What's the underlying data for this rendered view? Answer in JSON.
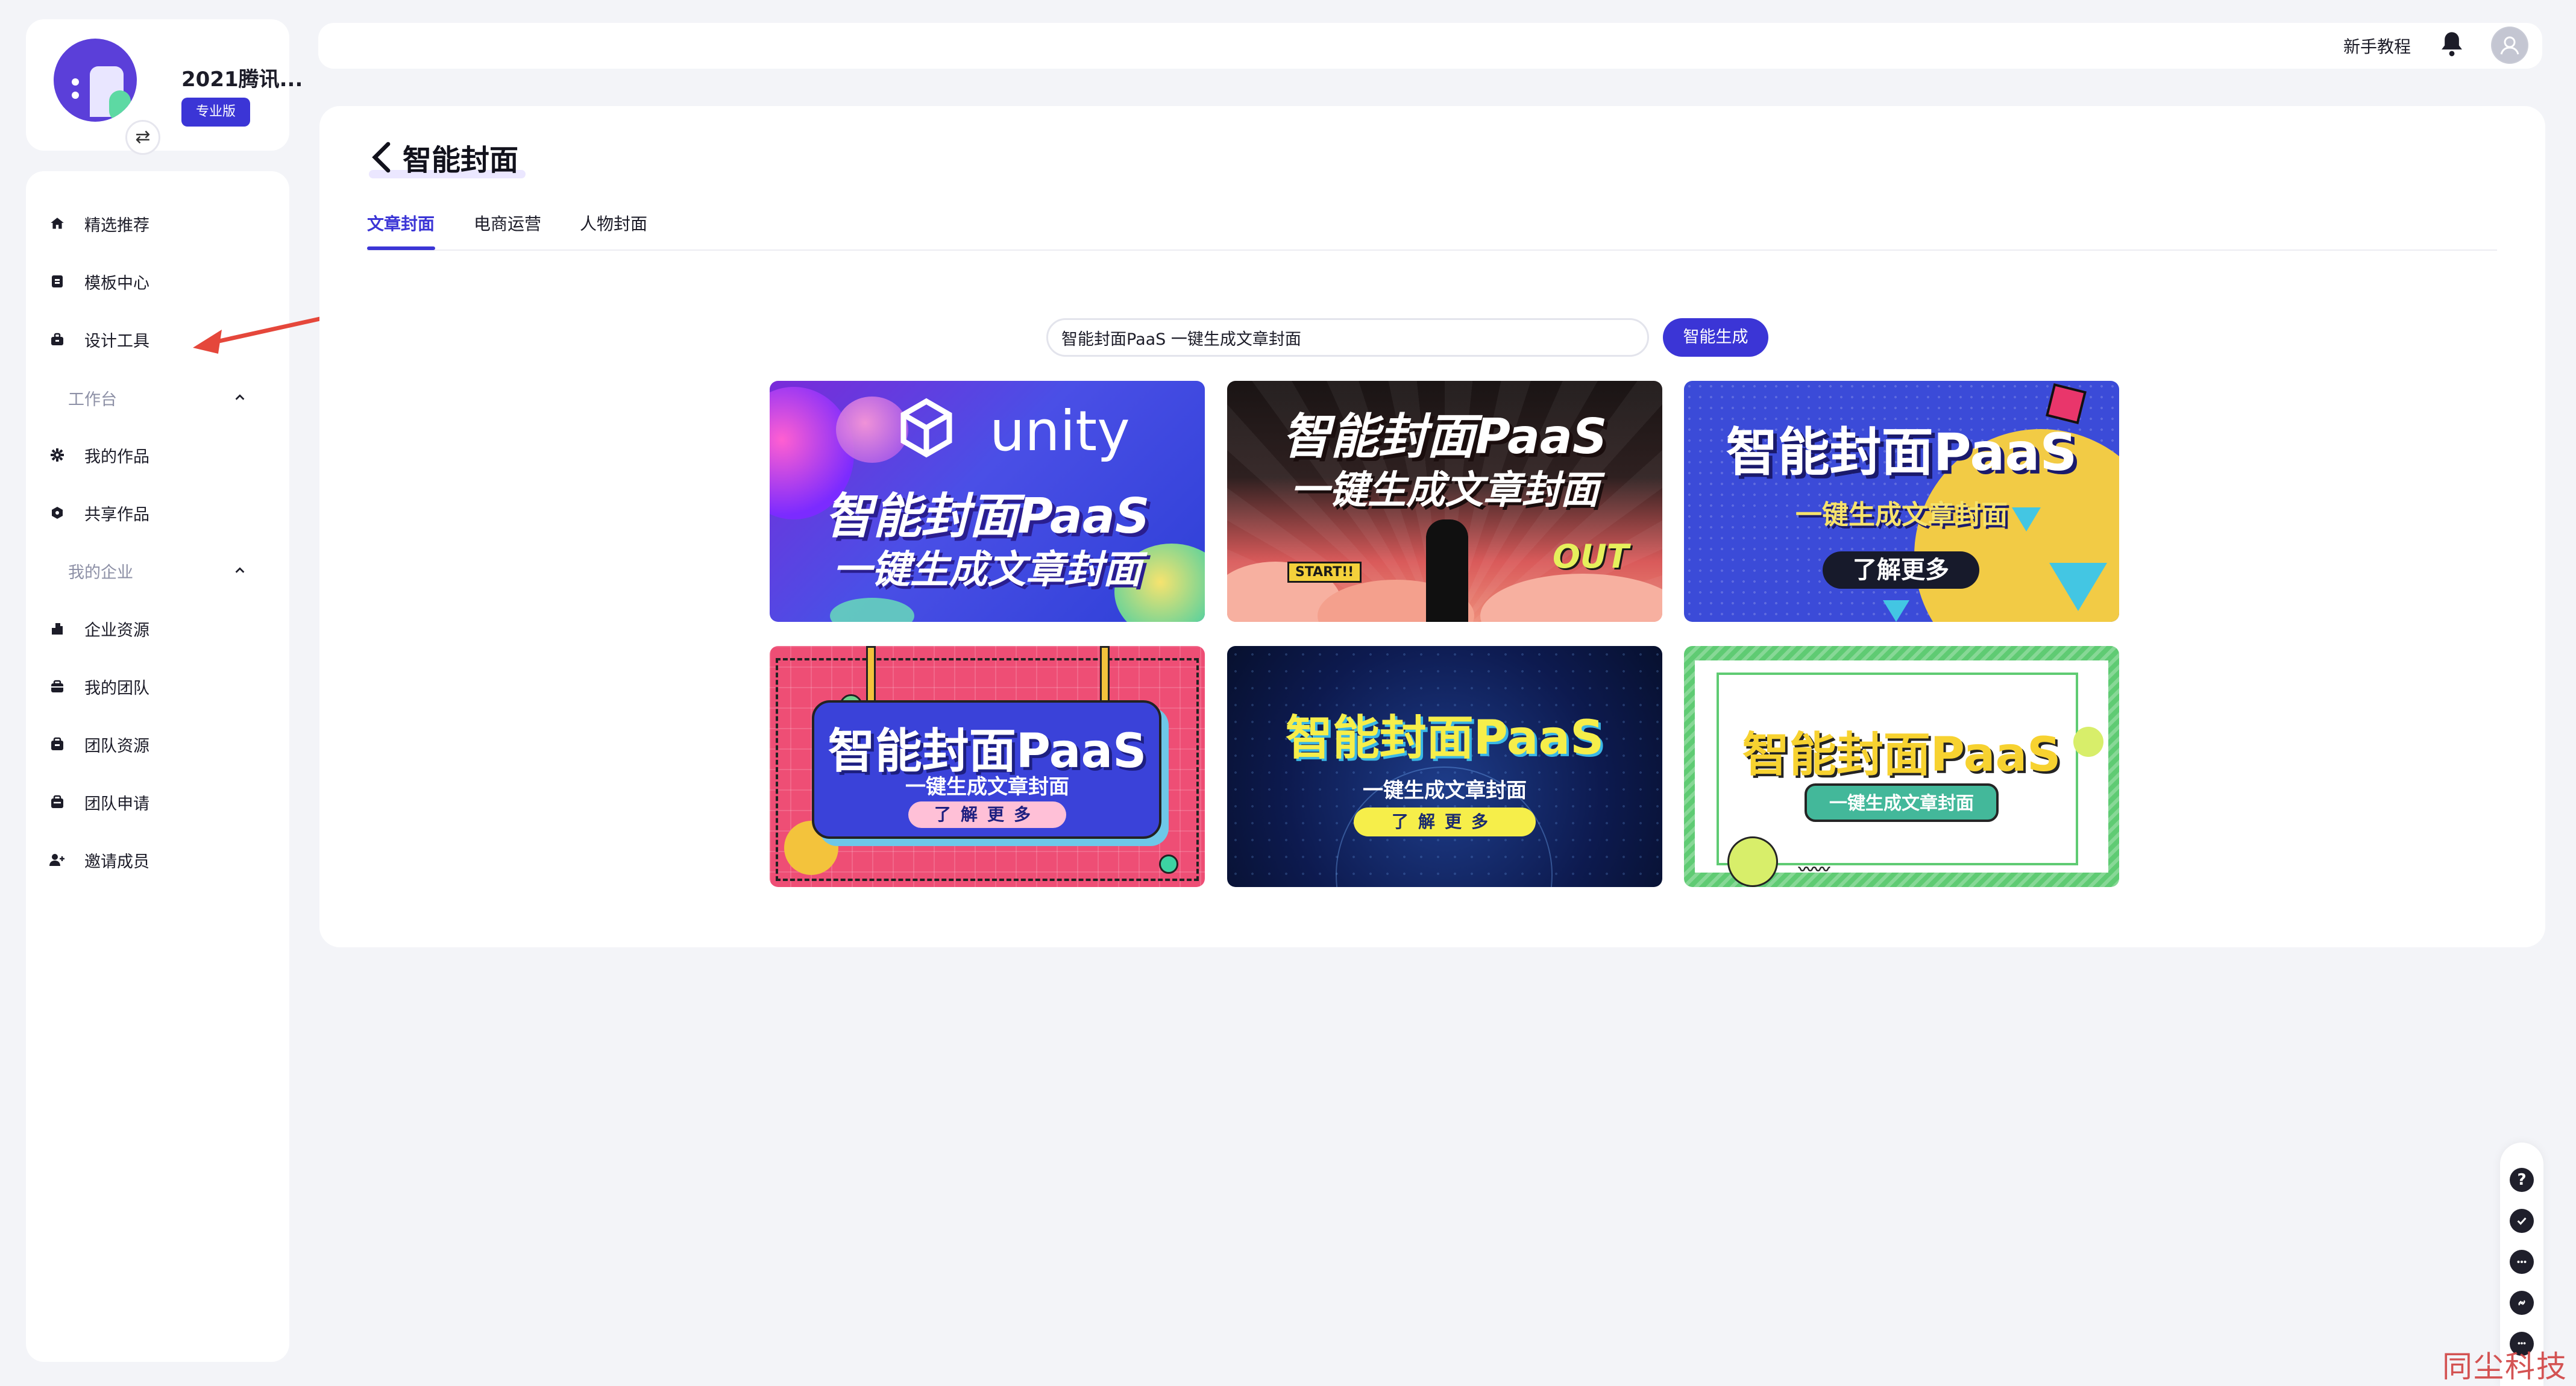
{
  "org": {
    "name": "2021腾讯...",
    "plan": "专业版"
  },
  "sidebar": {
    "top_items": [
      {
        "label": "精选推荐",
        "icon": "home-icon"
      },
      {
        "label": "模板中心",
        "icon": "template-icon"
      },
      {
        "label": "设计工具",
        "icon": "toolbox-icon"
      }
    ],
    "groups": [
      {
        "label": "工作台",
        "items": [
          {
            "label": "我的作品",
            "icon": "gear-icon"
          },
          {
            "label": "共享作品",
            "icon": "share-icon"
          }
        ]
      },
      {
        "label": "我的企业",
        "items": [
          {
            "label": "企业资源",
            "icon": "building-icon"
          },
          {
            "label": "我的团队",
            "icon": "team-icon"
          },
          {
            "label": "团队资源",
            "icon": "folder-icon"
          },
          {
            "label": "团队申请",
            "icon": "inbox-icon"
          },
          {
            "label": "邀请成员",
            "icon": "add-user-icon"
          }
        ]
      }
    ]
  },
  "topbar": {
    "help_label": "新手教程"
  },
  "page": {
    "title": "智能封面",
    "tabs": [
      {
        "label": "文章封面",
        "active": true
      },
      {
        "label": "电商运营",
        "active": false
      },
      {
        "label": "人物封面",
        "active": false
      }
    ],
    "search_value": "智能封面PaaS 一键生成文章封面",
    "generate_label": "智能生成"
  },
  "covers": [
    {
      "brand": "unity",
      "title": "智能封面PaaS",
      "subtitle": "一键生成文章封面"
    },
    {
      "title": "智能封面PaaS",
      "subtitle": "一键生成文章封面",
      "sign": "START!!",
      "tag": "OUT"
    },
    {
      "title": "智能封面PaaS",
      "subtitle": "一键生成文章封面",
      "cta": "了解更多"
    },
    {
      "title": "智能封面PaaS",
      "subtitle": "一键生成文章封面",
      "cta": "了解更多"
    },
    {
      "title": "智能封面PaaS",
      "subtitle": "一键生成文章封面",
      "cta": "了解更多"
    },
    {
      "title": "智能封面PaaS",
      "cta": "一键生成文章封面"
    }
  ],
  "watermark": "同尘科技",
  "colors": {
    "accent": "#3b35d6",
    "annotation_arrow": "#e5473b",
    "background": "#f3f4f8"
  }
}
